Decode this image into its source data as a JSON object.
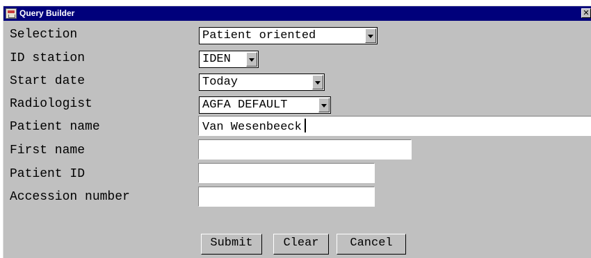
{
  "window": {
    "title": "Query Builder",
    "close_glyph": "✕"
  },
  "fields": {
    "selection": {
      "label": "Selection",
      "value": "Patient oriented"
    },
    "id_station": {
      "label": "ID station",
      "value": "IDEN"
    },
    "start_date": {
      "label": "Start date",
      "value": "Today"
    },
    "radiologist": {
      "label": "Radiologist",
      "value": "AGFA DEFAULT"
    },
    "patient_name": {
      "label": "Patient name",
      "value": "Van Wesenbeeck"
    },
    "first_name": {
      "label": "First name",
      "value": ""
    },
    "patient_id": {
      "label": "Patient ID",
      "value": ""
    },
    "accession_number": {
      "label": "Accession number",
      "value": ""
    }
  },
  "buttons": {
    "submit": "Submit",
    "clear": "Clear",
    "cancel": "Cancel"
  }
}
